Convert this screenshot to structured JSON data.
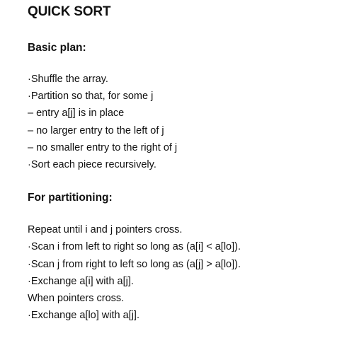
{
  "document": {
    "title": "QUICK SORT",
    "sections": [
      {
        "heading": "Basic plan:",
        "lines": [
          "·Shuffle the array.",
          "·Partition so that, for some j",
          "– entry a[j] is in place",
          "– no larger entry to the left of j",
          "– no smaller entry to the right of j",
          "·Sort each  piece recursively."
        ]
      },
      {
        "heading": "For partitioning:",
        "lines": [
          "Repeat until i and j pointers cross.",
          "·Scan i from left to right so long as (a[i] < a[lo]).",
          "·Scan j from right to left so long as (a[j] > a[lo]).",
          "·Exchange  a[i] with a[j].",
          "When pointers cross.",
          "·Exchange  a[lo] with a[j]."
        ]
      }
    ]
  }
}
